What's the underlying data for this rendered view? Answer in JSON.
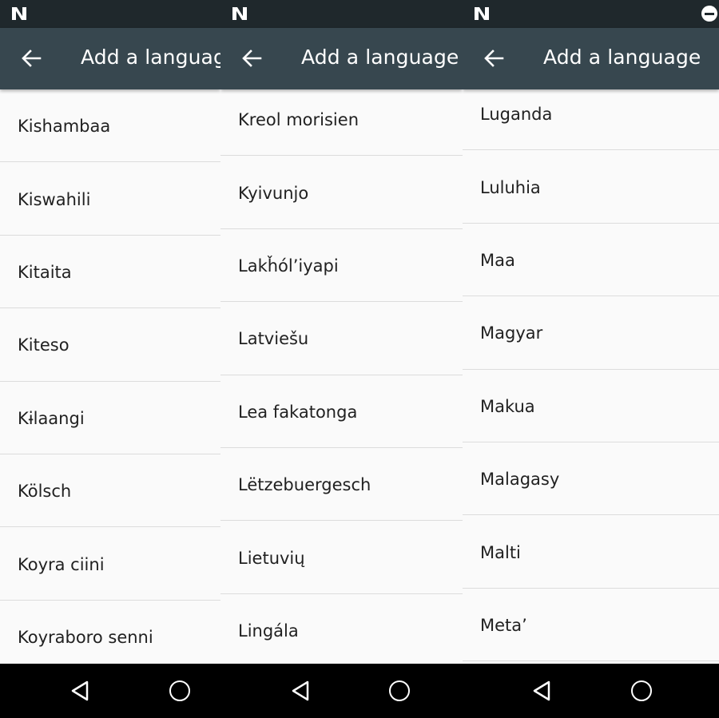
{
  "toolbar": {
    "title": "Add a language"
  },
  "panels": [
    {
      "items": [
        "Kishambaa",
        "Kiswahili",
        "Kitaita",
        "Kiteso",
        "Kɨlaangi",
        "Kölsch",
        "Koyra ciini",
        "Koyraboro senni"
      ]
    },
    {
      "items": [
        "Kreol morisien",
        "Kyivunjo",
        "Lakȟól’iyapi",
        "Latviešu",
        "Lea fakatonga",
        "Lëtzebuergesch",
        "Lietuvių",
        "Lingála"
      ]
    },
    {
      "items": [
        "Luganda",
        "Luluhia",
        "Maa",
        "Magyar",
        "Makua",
        "Malagasy",
        "Malti",
        "Meta’"
      ]
    }
  ],
  "icons": {
    "status_logo": "n-logo-icon",
    "status_dnd": "do-not-disturb-icon",
    "toolbar_back": "arrow-back-icon",
    "nav_back": "nav-back-triangle-icon",
    "nav_home": "nav-home-circle-icon"
  },
  "colors": {
    "status_bar": "#1f282c",
    "toolbar": "#37474f",
    "list_background": "#fafafa",
    "divider": "#dcdcdc",
    "text": "#212121",
    "nav_bar": "#000000"
  }
}
